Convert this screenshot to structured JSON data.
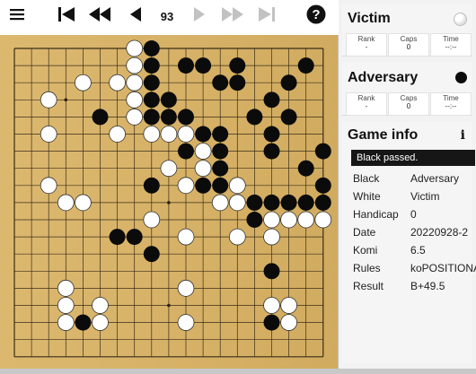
{
  "toolbar": {
    "menu_icon": "hamburger-icon",
    "move_number": "93",
    "help_icon": "question-icon"
  },
  "board": {
    "size": 19,
    "board_color": "#d9b263",
    "star_points": [
      [
        3,
        3
      ],
      [
        9,
        3
      ],
      [
        15,
        3
      ],
      [
        3,
        9
      ],
      [
        9,
        9
      ],
      [
        15,
        9
      ],
      [
        3,
        15
      ],
      [
        9,
        15
      ],
      [
        15,
        15
      ]
    ],
    "black_stones": [
      [
        8,
        0
      ],
      [
        8,
        1
      ],
      [
        10,
        1
      ],
      [
        11,
        1
      ],
      [
        13,
        1
      ],
      [
        17,
        1
      ],
      [
        8,
        2
      ],
      [
        12,
        2
      ],
      [
        13,
        2
      ],
      [
        16,
        2
      ],
      [
        8,
        3
      ],
      [
        9,
        3
      ],
      [
        15,
        3
      ],
      [
        5,
        4
      ],
      [
        8,
        4
      ],
      [
        9,
        4
      ],
      [
        10,
        4
      ],
      [
        14,
        4
      ],
      [
        16,
        4
      ],
      [
        10,
        5
      ],
      [
        11,
        5
      ],
      [
        12,
        5
      ],
      [
        15,
        5
      ],
      [
        10,
        6
      ],
      [
        12,
        6
      ],
      [
        15,
        6
      ],
      [
        18,
        6
      ],
      [
        12,
        7
      ],
      [
        17,
        7
      ],
      [
        8,
        8
      ],
      [
        11,
        8
      ],
      [
        12,
        8
      ],
      [
        18,
        8
      ],
      [
        14,
        9
      ],
      [
        15,
        9
      ],
      [
        16,
        9
      ],
      [
        17,
        9
      ],
      [
        18,
        9
      ],
      [
        14,
        10
      ],
      [
        6,
        11
      ],
      [
        7,
        11
      ],
      [
        8,
        12
      ],
      [
        15,
        13
      ],
      [
        4,
        16
      ],
      [
        15,
        16
      ]
    ],
    "white_stones": [
      [
        7,
        0
      ],
      [
        7,
        1
      ],
      [
        4,
        2
      ],
      [
        6,
        2
      ],
      [
        7,
        2
      ],
      [
        2,
        3
      ],
      [
        7,
        3
      ],
      [
        7,
        4
      ],
      [
        6,
        5
      ],
      [
        8,
        5
      ],
      [
        9,
        5
      ],
      [
        10,
        5
      ],
      [
        2,
        5
      ],
      [
        11,
        6
      ],
      [
        9,
        7
      ],
      [
        11,
        7
      ],
      [
        2,
        8
      ],
      [
        10,
        8
      ],
      [
        13,
        8
      ],
      [
        3,
        9
      ],
      [
        4,
        9
      ],
      [
        12,
        9
      ],
      [
        13,
        9
      ],
      [
        8,
        10
      ],
      [
        15,
        10
      ],
      [
        16,
        10
      ],
      [
        17,
        10
      ],
      [
        18,
        10
      ],
      [
        10,
        11
      ],
      [
        13,
        11
      ],
      [
        15,
        11
      ],
      [
        3,
        14
      ],
      [
        10,
        14
      ],
      [
        3,
        15
      ],
      [
        5,
        15
      ],
      [
        15,
        15
      ],
      [
        16,
        15
      ],
      [
        3,
        16
      ],
      [
        5,
        16
      ],
      [
        10,
        16
      ],
      [
        16,
        16
      ]
    ]
  },
  "players": {
    "white": {
      "name": "Victim",
      "stone_color": "white",
      "rank_label": "Rank",
      "rank_value": "-",
      "caps_label": "Caps",
      "caps_value": "0",
      "time_label": "Time",
      "time_value": "--:--"
    },
    "black": {
      "name": "Adversary",
      "stone_color": "black",
      "rank_label": "Rank",
      "rank_value": "-",
      "caps_label": "Caps",
      "caps_value": "0",
      "time_label": "Time",
      "time_value": "--:--"
    }
  },
  "game_info": {
    "title": "Game info",
    "notice": "Black passed.",
    "rows": [
      {
        "key": "Black",
        "value": "Adversary"
      },
      {
        "key": "White",
        "value": "Victim"
      },
      {
        "key": "Handicap",
        "value": "0"
      },
      {
        "key": "Date",
        "value": "20220928-2"
      },
      {
        "key": "Komi",
        "value": "6.5"
      },
      {
        "key": "Rules",
        "value": "koPOSITIONAL"
      },
      {
        "key": "Result",
        "value": "B+49.5"
      }
    ]
  }
}
